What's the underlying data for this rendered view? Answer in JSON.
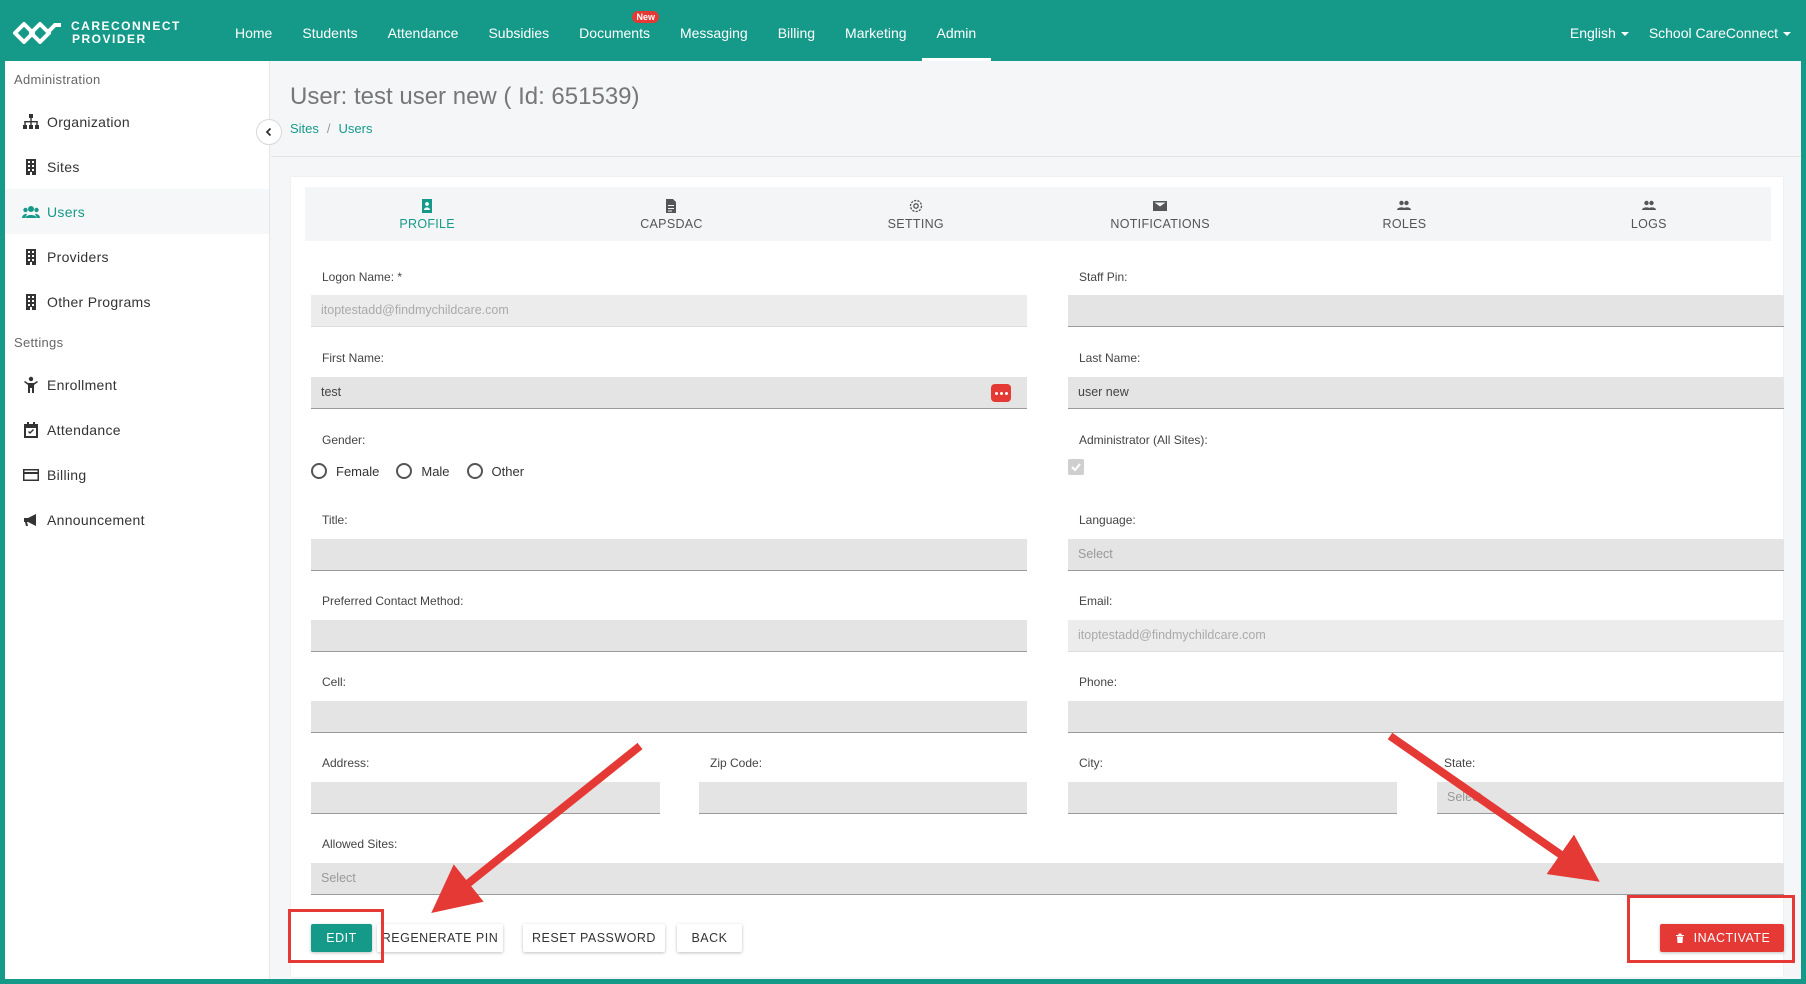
{
  "brand": {
    "line1": "CARECONNECT",
    "line2": "PROVIDER"
  },
  "nav": {
    "items": [
      "Home",
      "Students",
      "Attendance",
      "Subsidies",
      "Documents",
      "Messaging",
      "Billing",
      "Marketing",
      "Admin"
    ],
    "new_badge": "New",
    "language": "English",
    "account": "School CareConnect"
  },
  "sidebar": {
    "section_admin": "Administration",
    "admin_items": [
      "Organization",
      "Sites",
      "Users",
      "Providers",
      "Other Programs"
    ],
    "section_settings": "Settings",
    "settings_items": [
      "Enrollment",
      "Attendance",
      "Billing",
      "Announcement"
    ]
  },
  "page": {
    "title": "User: test user new ( Id: 651539)",
    "breadcrumb": [
      "Sites",
      "Users"
    ]
  },
  "tabs": [
    "PROFILE",
    "CAPSDAC",
    "SETTING",
    "NOTIFICATIONS",
    "ROLES",
    "LOGS"
  ],
  "form": {
    "logon_label": "Logon Name: *",
    "logon_value": "itoptestadd@findmychildcare.com",
    "staff_pin_label": "Staff Pin:",
    "first_name_label": "First Name:",
    "first_name_value": "test",
    "last_name_label": "Last Name:",
    "last_name_value": "user new",
    "gender_label": "Gender:",
    "gender_options": [
      "Female",
      "Male",
      "Other"
    ],
    "admin_label": "Administrator (All Sites):",
    "title_label": "Title:",
    "language_label": "Language:",
    "language_placeholder": "Select",
    "contact_label": "Preferred Contact Method:",
    "email_label": "Email:",
    "email_value": "itoptestadd@findmychildcare.com",
    "cell_label": "Cell:",
    "phone_label": "Phone:",
    "address_label": "Address:",
    "zip_label": "Zip Code:",
    "city_label": "City:",
    "state_label": "State:",
    "state_placeholder": "Select",
    "allowed_sites_label": "Allowed Sites:",
    "allowed_sites_placeholder": "Select"
  },
  "buttons": {
    "edit": "EDIT",
    "regenerate": "REGENERATE PIN",
    "reset": "RESET PASSWORD",
    "back": "BACK",
    "inactivate": "INACTIVATE"
  },
  "colors": {
    "primary": "#159a8a",
    "danger": "#e53935",
    "annotation": "#e53935"
  }
}
